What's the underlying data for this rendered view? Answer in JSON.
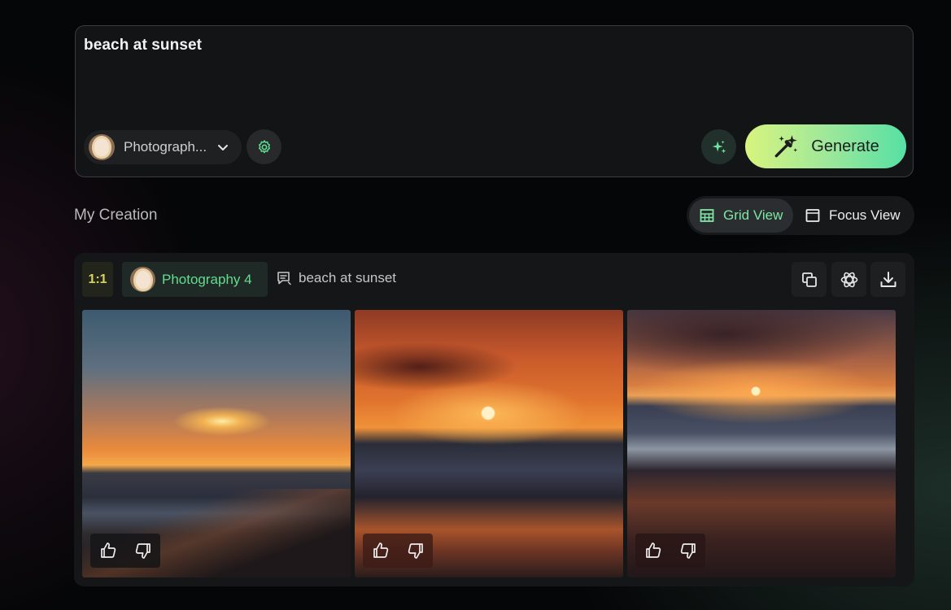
{
  "prompt": {
    "text": "beach at sunset",
    "model_select_label": "Photograph...",
    "generate_label": "Generate"
  },
  "section": {
    "title": "My Creation",
    "views": [
      {
        "label": "Grid View",
        "active": true
      },
      {
        "label": "Focus View",
        "active": false
      }
    ]
  },
  "creation": {
    "aspect_ratio": "1:1",
    "model_name": "Photography 4",
    "prompt_text": "beach at sunset",
    "images": [
      {
        "subject": "sunset over beach, waves, wet sand"
      },
      {
        "subject": "orange sky sunset over sea with clouds"
      },
      {
        "subject": "dramatic clouds sunset, foamy waves on shore"
      }
    ]
  },
  "colors": {
    "accent_green": "#7ee6a3",
    "generate_gradient_start": "#d7f47e",
    "generate_gradient_end": "#56e0a4",
    "ratio_badge_text": "#d7d45e"
  },
  "icons": [
    "chevron-down-icon",
    "settings-gear-icon",
    "sparkles-icon",
    "magic-wand-icon",
    "grid-icon",
    "focus-window-icon",
    "prompt-text-icon",
    "copy-icon",
    "remix-icon",
    "download-icon",
    "thumbs-up-icon",
    "thumbs-down-icon"
  ]
}
